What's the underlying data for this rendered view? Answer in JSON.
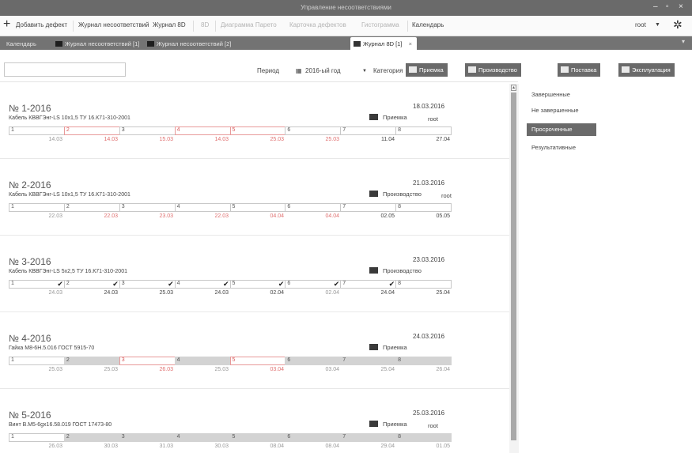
{
  "window": {
    "title": "Управление несоответствиями",
    "controls": [
      "–",
      "▫",
      "×"
    ]
  },
  "toolbar": {
    "items": [
      {
        "label": "Добавить дефект",
        "dim": false
      },
      {
        "label": "Журнал несоответствий",
        "dim": false
      },
      {
        "label": "Журнал 8D",
        "dim": false
      },
      {
        "label": "8D",
        "dim": true
      },
      {
        "label": "Диаграмма Парето",
        "dim": true
      },
      {
        "label": "Карточка дефектов",
        "dim": true
      },
      {
        "label": "Гистограмма",
        "dim": true
      },
      {
        "label": "Календарь",
        "dim": false
      }
    ],
    "user": "root",
    "user_caret": "▼",
    "settings_icon": "gear-icon"
  },
  "tabs": [
    {
      "label": "Календарь",
      "active": false
    },
    {
      "label": "Журнал несоответствий [1]",
      "active": false
    },
    {
      "label": "Журнал несоответствий [2]",
      "active": false
    },
    {
      "label": "Журнал 8D [1]",
      "active": true
    }
  ],
  "filter": {
    "search_value": "",
    "period_label": "Период",
    "period_value": "2016-ый год",
    "category_label": "Категория",
    "category_buttons": [
      "Приемка",
      "Производство",
      "Поставка",
      "Эксплуатация"
    ]
  },
  "records": [
    {
      "number": "№ 1-2016",
      "date": "18.03.2016",
      "name": "Кабель КВВГЭнг-LS 10х1,5 ТУ 16.К71-310-2001",
      "category": "Приемка",
      "user": "root",
      "stages": [
        {
          "n": "1",
          "state": "open",
          "date": "14.03",
          "date_style": "normal"
        },
        {
          "n": "2",
          "state": "red",
          "date": "14.03",
          "date_style": "red"
        },
        {
          "n": "3",
          "state": "open",
          "date": "15.03",
          "date_style": "red"
        },
        {
          "n": "4",
          "state": "red",
          "date": "14.03",
          "date_style": "red"
        },
        {
          "n": "5",
          "state": "red",
          "date": "25.03",
          "date_style": "red"
        },
        {
          "n": "6",
          "state": "open",
          "date": "25.03",
          "date_style": "red"
        },
        {
          "n": "7",
          "state": "open",
          "date": "11.04",
          "date_style": "dark"
        },
        {
          "n": "8",
          "state": "open",
          "date": "27.04",
          "date_style": "dark"
        }
      ]
    },
    {
      "number": "№ 2-2016",
      "date": "21.03.2016",
      "name": "Кабель КВВГЭнг-LS 10х1,5 ТУ 16.К71-310-2001",
      "category": "Производство",
      "user": "root",
      "stages": [
        {
          "n": "1",
          "state": "open",
          "date": "22.03",
          "date_style": "normal"
        },
        {
          "n": "2",
          "state": "open",
          "date": "22.03",
          "date_style": "red"
        },
        {
          "n": "3",
          "state": "open",
          "date": "23.03",
          "date_style": "red"
        },
        {
          "n": "4",
          "state": "open",
          "date": "22.03",
          "date_style": "red"
        },
        {
          "n": "5",
          "state": "open",
          "date": "04.04",
          "date_style": "red"
        },
        {
          "n": "6",
          "state": "open",
          "date": "04.04",
          "date_style": "red"
        },
        {
          "n": "7",
          "state": "open",
          "date": "02.05",
          "date_style": "dark"
        },
        {
          "n": "8",
          "state": "open",
          "date": "05.05",
          "date_style": "dark"
        }
      ]
    },
    {
      "number": "№ 3-2016",
      "date": "23.03.2016",
      "name": "Кабель КВВГЭнг-LS 5х2,5 ТУ 16.К71-310-2001",
      "category": "Производство",
      "user": "",
      "stages": [
        {
          "n": "1",
          "state": "done",
          "date": "24.03",
          "date_style": "normal"
        },
        {
          "n": "2",
          "state": "done",
          "date": "24.03",
          "date_style": "dark"
        },
        {
          "n": "3",
          "state": "done",
          "date": "25.03",
          "date_style": "dark"
        },
        {
          "n": "4",
          "state": "done",
          "date": "24.03",
          "date_style": "dark"
        },
        {
          "n": "5",
          "state": "done",
          "date": "02.04",
          "date_style": "dark"
        },
        {
          "n": "6",
          "state": "done",
          "date": "02.04",
          "date_style": "normal"
        },
        {
          "n": "7",
          "state": "done",
          "date": "24.04",
          "date_style": "dark"
        },
        {
          "n": "8",
          "state": "open",
          "date": "25.04",
          "date_style": "dark"
        }
      ]
    },
    {
      "number": "№ 4-2016",
      "date": "24.03.2016",
      "name": "Гайка М8-6Н.5.016 ГОСТ 5915-70",
      "category": "Приемка",
      "user": "",
      "stages": [
        {
          "n": "1",
          "state": "open",
          "date": "25.03",
          "date_style": "normal"
        },
        {
          "n": "2",
          "state": "grey",
          "date": "25.03",
          "date_style": "normal"
        },
        {
          "n": "3",
          "state": "red",
          "date": "26.03",
          "date_style": "red"
        },
        {
          "n": "4",
          "state": "grey",
          "date": "25.03",
          "date_style": "normal"
        },
        {
          "n": "5",
          "state": "red",
          "date": "03.04",
          "date_style": "red"
        },
        {
          "n": "6",
          "state": "grey",
          "date": "03.04",
          "date_style": "normal"
        },
        {
          "n": "7",
          "state": "grey",
          "date": "25.04",
          "date_style": "normal"
        },
        {
          "n": "8",
          "state": "grey",
          "date": "26.04",
          "date_style": "normal"
        }
      ]
    },
    {
      "number": "№ 5-2016",
      "date": "25.03.2016",
      "name": "Винт В.М5-6gх16.58.019 ГОСТ 17473-80",
      "category": "Приемка",
      "user": "root",
      "stages": [
        {
          "n": "1",
          "state": "open",
          "date": "26.03",
          "date_style": "normal"
        },
        {
          "n": "2",
          "state": "grey",
          "date": "30.03",
          "date_style": "normal"
        },
        {
          "n": "3",
          "state": "grey",
          "date": "31.03",
          "date_style": "normal"
        },
        {
          "n": "4",
          "state": "grey",
          "date": "30.03",
          "date_style": "normal"
        },
        {
          "n": "5",
          "state": "grey",
          "date": "08.04",
          "date_style": "normal"
        },
        {
          "n": "6",
          "state": "grey",
          "date": "08.04",
          "date_style": "normal"
        },
        {
          "n": "7",
          "state": "grey",
          "date": "29.04",
          "date_style": "normal"
        },
        {
          "n": "8",
          "state": "grey",
          "date": "01.05",
          "date_style": "normal"
        }
      ]
    }
  ],
  "sidebar": {
    "items": [
      {
        "label": "Завершенные",
        "active": false
      },
      {
        "label": "Не завершенные",
        "active": false
      },
      {
        "label": "Просроченные",
        "active": true
      },
      {
        "label": "Результативные",
        "active": false
      }
    ]
  }
}
